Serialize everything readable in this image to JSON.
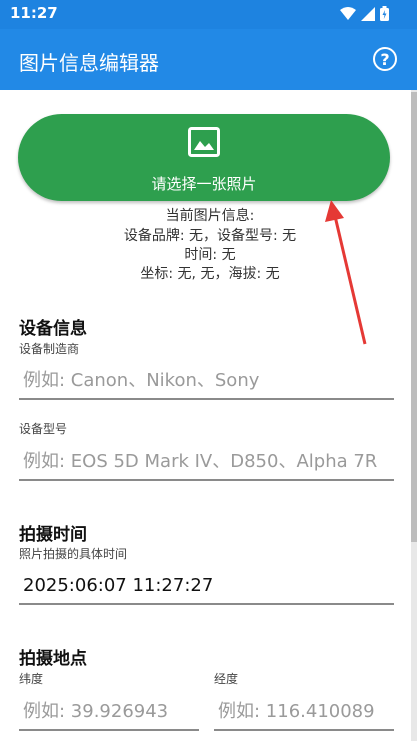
{
  "status_bar": {
    "time": "11:27",
    "icons": [
      "wifi-icon",
      "signal-icon",
      "battery-icon"
    ]
  },
  "app_bar": {
    "title": "图片信息编辑器",
    "help_icon": "help-circle-icon",
    "help_glyph": "?"
  },
  "photo_picker": {
    "icon": "image-icon",
    "label": "请选择一张照片"
  },
  "current_info": {
    "heading": "当前图片信息:",
    "device_line": "设备品牌: 无，设备型号: 无",
    "time_line": "时间: 无",
    "coord_line": "坐标: 无, 无，海拔: 无"
  },
  "device_section": {
    "title": "设备信息",
    "make_label": "设备制造商",
    "make_placeholder": "例如: Canon、Nikon、Sony",
    "model_label": "设备型号",
    "model_placeholder": "例如: EOS 5D Mark IV、D850、Alpha 7R"
  },
  "time_section": {
    "title": "拍摄时间",
    "subtitle": "照片拍摄的具体时间",
    "datetime_value": "2025:06:07 11:27:27"
  },
  "location_section": {
    "title": "拍摄地点",
    "latitude_label": "纬度",
    "latitude_placeholder": "例如: 39.926943",
    "longitude_label": "经度",
    "longitude_placeholder": "例如: 116.410089"
  },
  "colors": {
    "app_bar": "#2289e6",
    "status_bar": "#1e83e0",
    "button": "#2e9f4e",
    "annotation_arrow": "#e53935"
  }
}
